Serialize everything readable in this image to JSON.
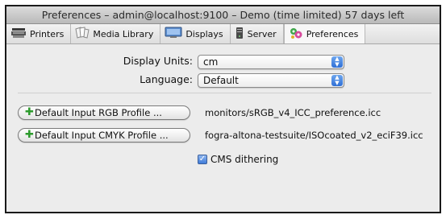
{
  "window": {
    "title": "Preferences – admin@localhost:9100 – Demo (time limited) 57 days left"
  },
  "tabs": [
    {
      "label": "Printers",
      "icon": "printer-icon"
    },
    {
      "label": "Media Library",
      "icon": "media-library-icon"
    },
    {
      "label": "Displays",
      "icon": "display-icon"
    },
    {
      "label": "Server",
      "icon": "server-icon"
    },
    {
      "label": "Preferences",
      "icon": "preferences-icon",
      "active": true
    }
  ],
  "form": {
    "display_units": {
      "label": "Display Units:",
      "value": "cm"
    },
    "language": {
      "label": "Language:",
      "value": "Default"
    }
  },
  "profiles": {
    "rgb": {
      "button_label": "Default Input RGB Profile ...",
      "path": "monitors/sRGB_v4_ICC_preference.icc"
    },
    "cmyk": {
      "button_label": "Default Input CMYK Profile ...",
      "path": "fogra-altona-testsuite/ISOcoated_v2_eciF39.icc"
    }
  },
  "cms_dithering": {
    "label": "CMS dithering",
    "checked": true
  },
  "colors": {
    "accent": "#2f6fd6",
    "plus_green": "#2c9a2c",
    "window_bg": "#ececec"
  }
}
